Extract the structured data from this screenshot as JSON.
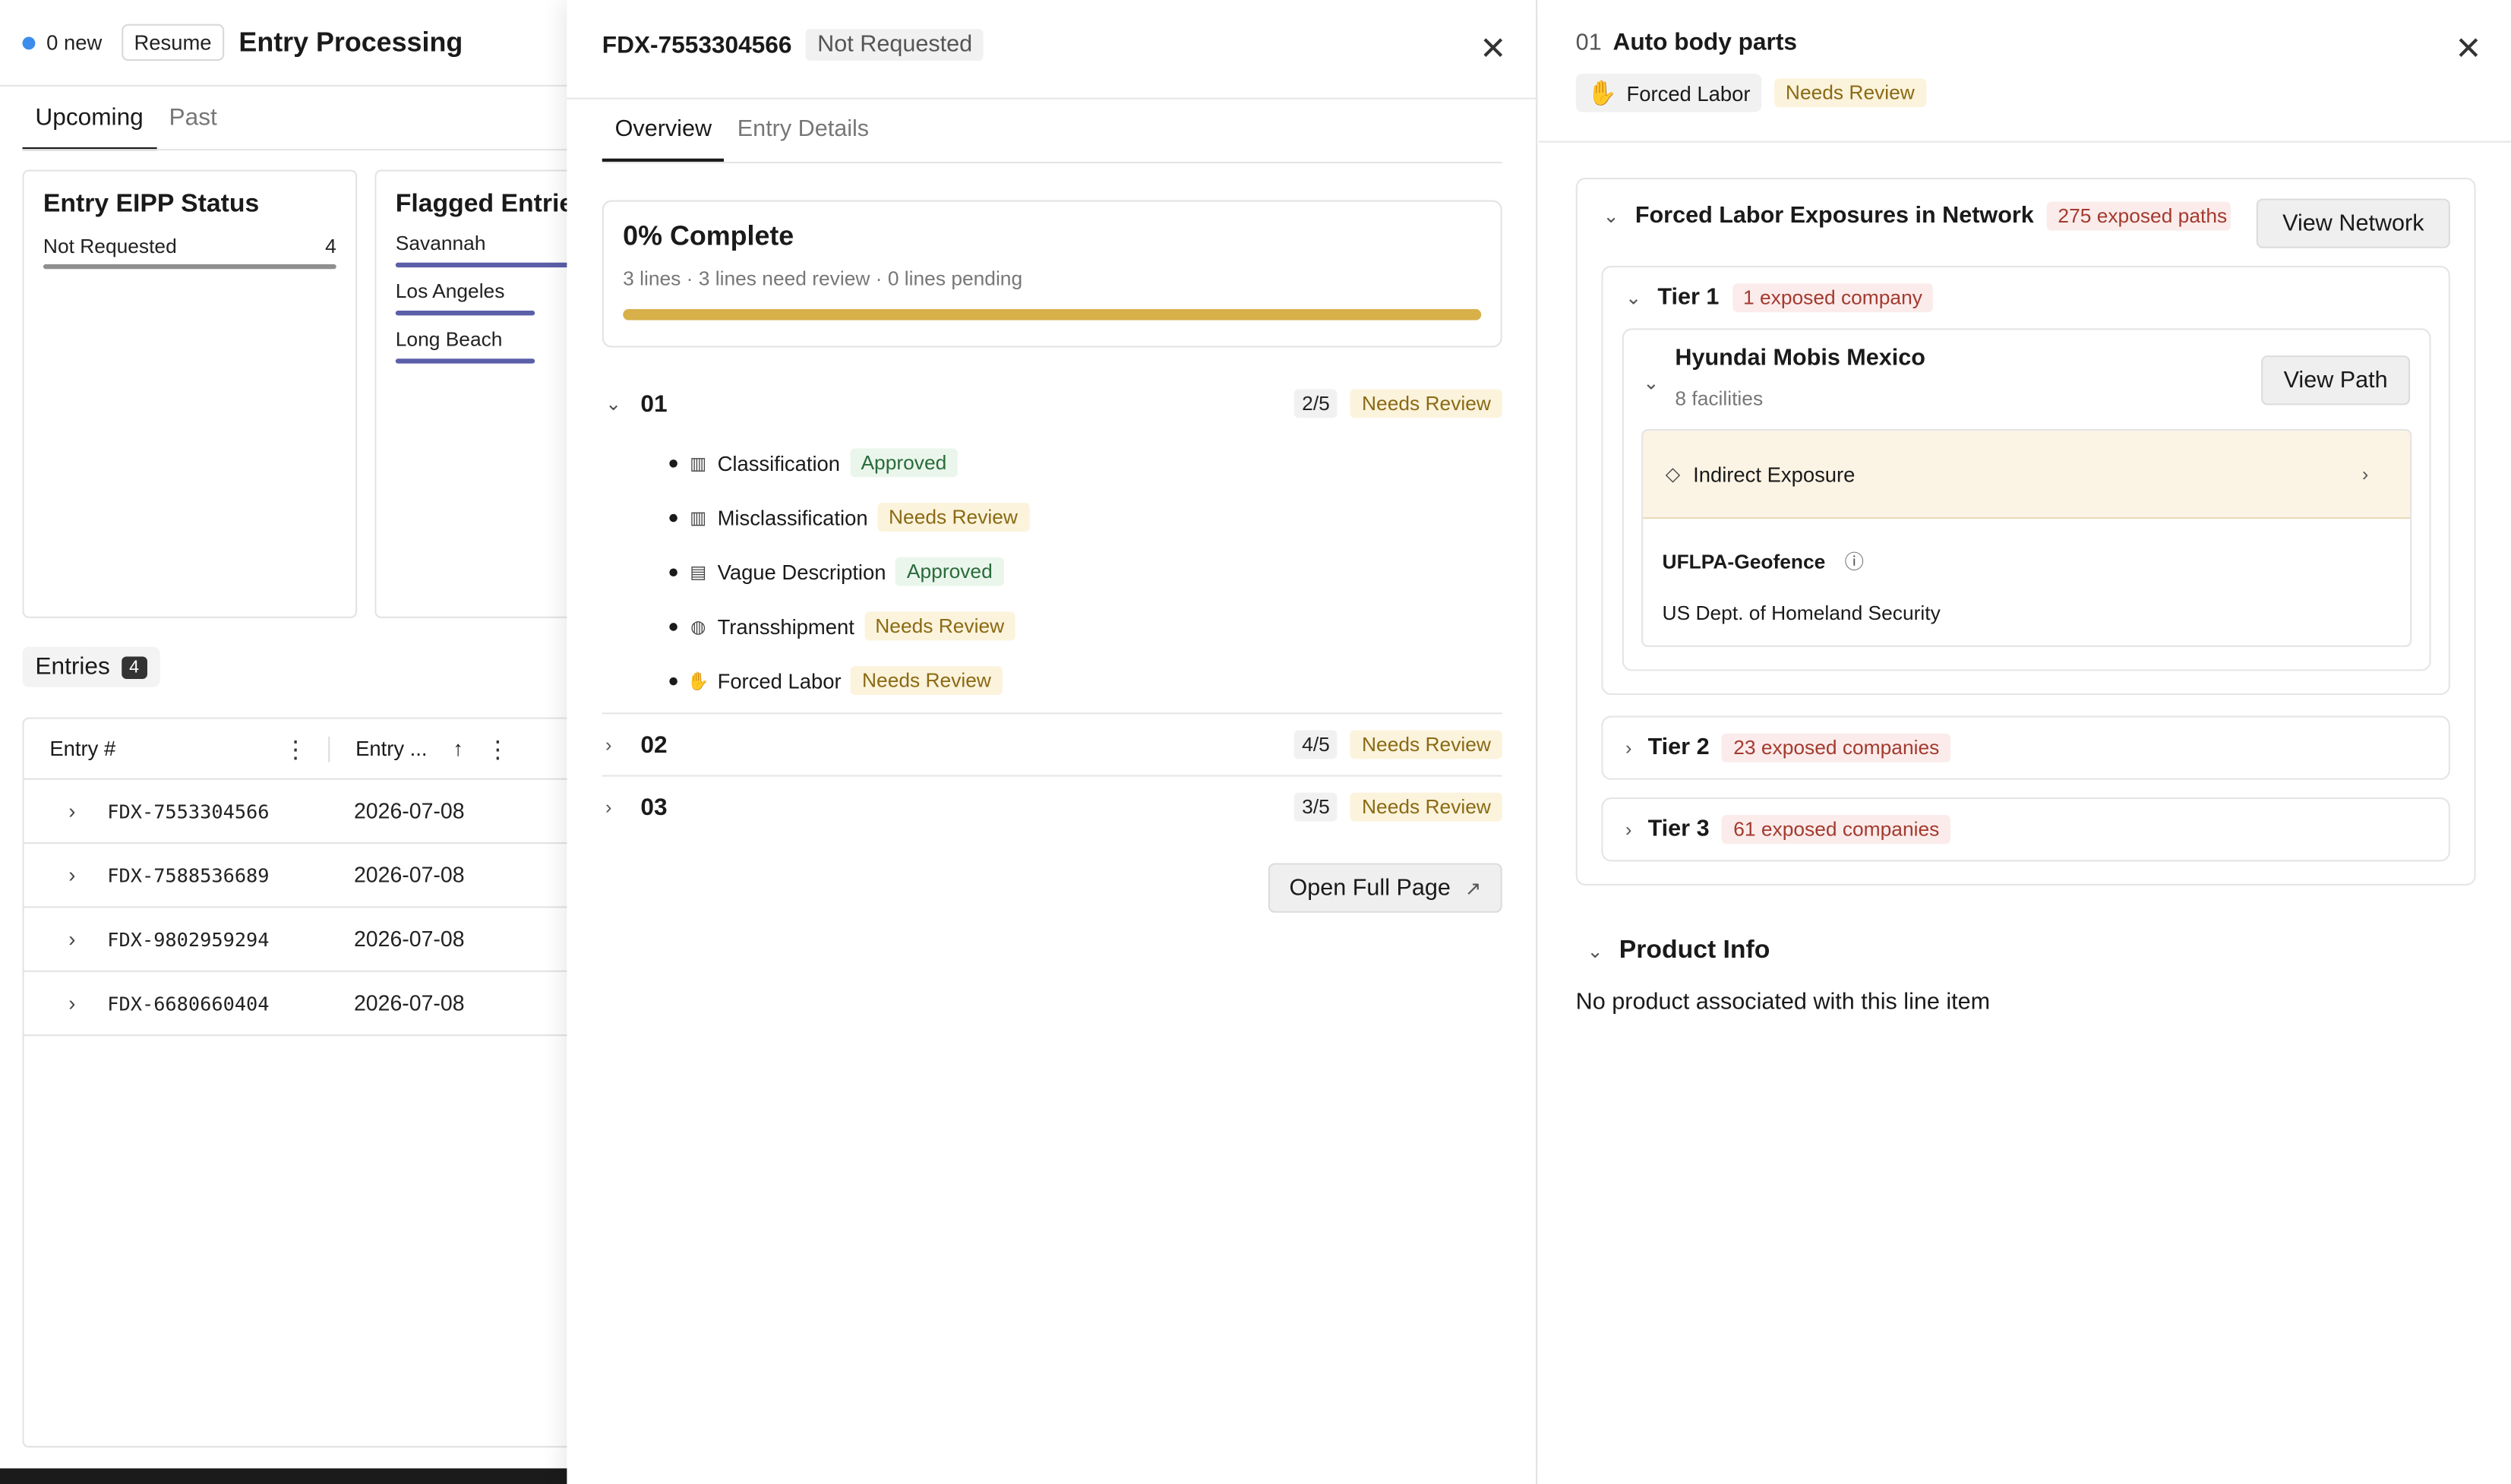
{
  "app": {
    "new_count": "0 new",
    "resume_label": "Resume",
    "title": "Entry Processing",
    "tabs": [
      "Upcoming",
      "Past"
    ]
  },
  "eipp_card": {
    "title": "Entry EIPP Status",
    "rows": [
      {
        "label": "Not Requested",
        "count": "4"
      }
    ]
  },
  "flagged_card": {
    "title": "Flagged Entries",
    "rows": [
      {
        "label": "Savannah",
        "fraction": 1.0
      },
      {
        "label": "Los Angeles",
        "fraction": 0.5
      },
      {
        "label": "Long Beach",
        "fraction": 0.5
      }
    ]
  },
  "entries": {
    "label": "Entries",
    "count": "4",
    "columns": [
      "Entry #",
      "Entry ..."
    ],
    "rows": [
      {
        "entry_no": "FDX-7553304566",
        "date": "2026-07-08"
      },
      {
        "entry_no": "FDX-7588536689",
        "date": "2026-07-08"
      },
      {
        "entry_no": "FDX-9802959294",
        "date": "2026-07-08"
      },
      {
        "entry_no": "FDX-6680660404",
        "date": "2026-07-08"
      }
    ]
  },
  "detail": {
    "entry_no": "FDX-7553304566",
    "status": "Not Requested",
    "tabs": [
      "Overview",
      "Entry Details"
    ],
    "progress": {
      "title": "0% Complete",
      "subtitle": "3 lines · 3 lines need review · 0 lines pending",
      "fill_fraction": 1.0,
      "color": "#d8b04a"
    },
    "lines": [
      {
        "no": "01",
        "count": "2/5",
        "status": "Needs Review"
      },
      {
        "no": "02",
        "count": "4/5",
        "status": "Needs Review"
      },
      {
        "no": "03",
        "count": "3/5",
        "status": "Needs Review"
      }
    ],
    "checks": [
      {
        "icon": "barcode-icon",
        "label": "Classification",
        "status": "Approved"
      },
      {
        "icon": "barcode-icon",
        "label": "Misclassification",
        "status": "Needs Review"
      },
      {
        "icon": "book-icon",
        "label": "Vague Description",
        "status": "Approved"
      },
      {
        "icon": "globe-icon",
        "label": "Transshipment",
        "status": "Needs Review"
      },
      {
        "icon": "hand-icon",
        "label": "Forced Labor",
        "status": "Needs Review"
      }
    ],
    "open_full_label": "Open Full Page"
  },
  "line_panel": {
    "line_no": "01",
    "title": "Auto body parts",
    "tag_label": "Forced Labor",
    "tag_status": "Needs Review",
    "exposures": {
      "title": "Forced Labor Exposures in Network",
      "paths_badge": "275 exposed paths",
      "view_network_label": "View Network"
    },
    "tiers": [
      {
        "label": "Tier 1",
        "badge": "1 exposed company"
      },
      {
        "label": "Tier 2",
        "badge": "23 exposed companies"
      },
      {
        "label": "Tier 3",
        "badge": "61 exposed companies"
      }
    ],
    "company": {
      "name": "Hyundai Mobis Mexico",
      "facilities": "8 facilities",
      "view_path_label": "View Path",
      "exposure_type": "Indirect Exposure",
      "geo_title": "UFLPA-Geofence",
      "agency": "US Dept. of Homeland Security"
    },
    "product_info": {
      "title": "Product Info",
      "text": "No product associated with this line item"
    }
  }
}
